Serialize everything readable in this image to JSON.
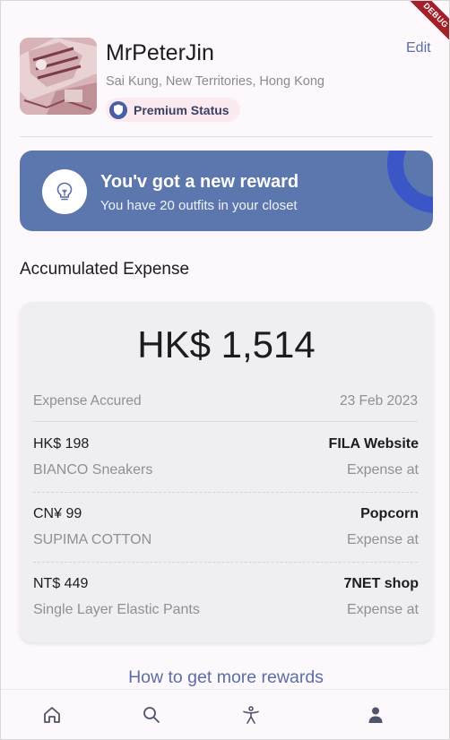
{
  "profile": {
    "name": "MrPeterJin",
    "location": "Sai Kung, New Territories, Hong Kong",
    "badge_label": "Premium Status",
    "edit_label": "Edit"
  },
  "debug_banner": "DEBUG",
  "reward": {
    "title": "You'v got a new reward",
    "subtitle": "You have 20 outfits in your closet",
    "icon": "lightbulb-icon"
  },
  "expense": {
    "section_title": "Accumulated Expense",
    "total": "HK$ 1,514",
    "accrued_label": "Expense Accured",
    "accrued_date": "23 Feb 2023",
    "items": [
      {
        "amount": "HK$ 198",
        "name": "BIANCO Sneakers",
        "store": "FILA Website",
        "store_label": "Expense at"
      },
      {
        "amount": "CN¥ 99",
        "name": "SUPIMA COTTON",
        "store": "Popcorn",
        "store_label": "Expense at"
      },
      {
        "amount": "NT$ 449",
        "name": "Single Layer Elastic Pants",
        "store": "7NET shop",
        "store_label": "Expense at"
      }
    ]
  },
  "more_link": "How to get more rewards",
  "bottom_nav": [
    {
      "icon": "home-icon"
    },
    {
      "icon": "search-icon"
    },
    {
      "icon": "accessibility-icon"
    },
    {
      "icon": "person-icon",
      "active": true
    }
  ],
  "colors": {
    "accent": "#5b6ea8",
    "reward_card": "#5c76ae",
    "reward_arc": "#3b56c7",
    "background": "#fdf8fb",
    "card": "#efeff3"
  }
}
